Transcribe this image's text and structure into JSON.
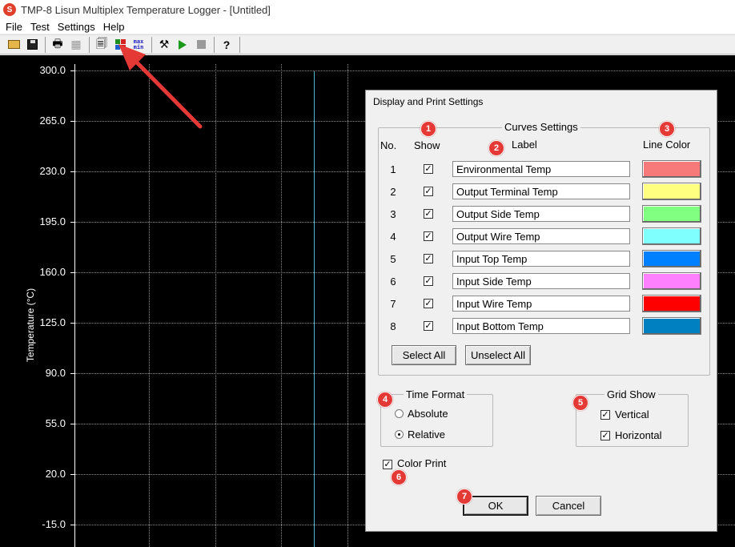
{
  "window": {
    "title": "TMP-8 Lisun Multiplex Temperature Logger - [Untitled]",
    "app_icon": "S"
  },
  "menu": [
    "File",
    "Test",
    "Settings",
    "Help"
  ],
  "toolbar": {
    "icons": [
      "open-icon",
      "save-icon",
      "print-icon",
      "print-preview-icon",
      "properties-icon",
      "display-settings-icon",
      "max-min-icon",
      "tools-icon",
      "start-icon",
      "stop-icon",
      "help-icon"
    ],
    "maxmin_label": "max min"
  },
  "chart": {
    "y_title": "Temperature (°C)",
    "y_ticks": [
      "300.0",
      "265.0",
      "230.0",
      "195.0",
      "160.0",
      "125.0",
      "90.0",
      "55.0",
      "20.0",
      "-15.0"
    ],
    "background": "#000000",
    "grid_color": "#8a8a8a",
    "cursor_color": "#4fb6cc"
  },
  "dialog": {
    "title": "Display and Print Settings",
    "curves": {
      "group_label": "Curves Settings",
      "col_no": "No.",
      "col_show": "Show",
      "col_label": "Label",
      "col_color": "Line Color",
      "rows": [
        {
          "no": "1",
          "show": true,
          "label": "Environmental Temp",
          "color": "#f77a7a"
        },
        {
          "no": "2",
          "show": true,
          "label": "Output Terminal Temp",
          "color": "#ffff80"
        },
        {
          "no": "3",
          "show": true,
          "label": "Output Side Temp",
          "color": "#80ff80"
        },
        {
          "no": "4",
          "show": true,
          "label": "Output Wire Temp",
          "color": "#80ffff"
        },
        {
          "no": "5",
          "show": true,
          "label": "Input Top Temp",
          "color": "#0080ff"
        },
        {
          "no": "6",
          "show": true,
          "label": "Input Side Temp",
          "color": "#ff80ff"
        },
        {
          "no": "7",
          "show": true,
          "label": "Input Wire Temp",
          "color": "#ff0000"
        },
        {
          "no": "8",
          "show": true,
          "label": "Input Bottom Temp",
          "color": "#0080c0"
        }
      ],
      "select_all": "Select All",
      "unselect_all": "Unselect All"
    },
    "time_format": {
      "label": "Time Format",
      "options": [
        "Absolute",
        "Relative"
      ],
      "selected": "Relative"
    },
    "grid_show": {
      "label": "Grid Show",
      "vertical": "Vertical",
      "vertical_checked": true,
      "horizontal": "Horizontal",
      "horizontal_checked": true
    },
    "color_print": {
      "label": "Color Print",
      "checked": true
    },
    "ok": "OK",
    "cancel": "Cancel",
    "check_mark": "✓"
  },
  "annotations": [
    "1",
    "2",
    "3",
    "4",
    "5",
    "6",
    "7"
  ],
  "accent_color": "#e53935"
}
